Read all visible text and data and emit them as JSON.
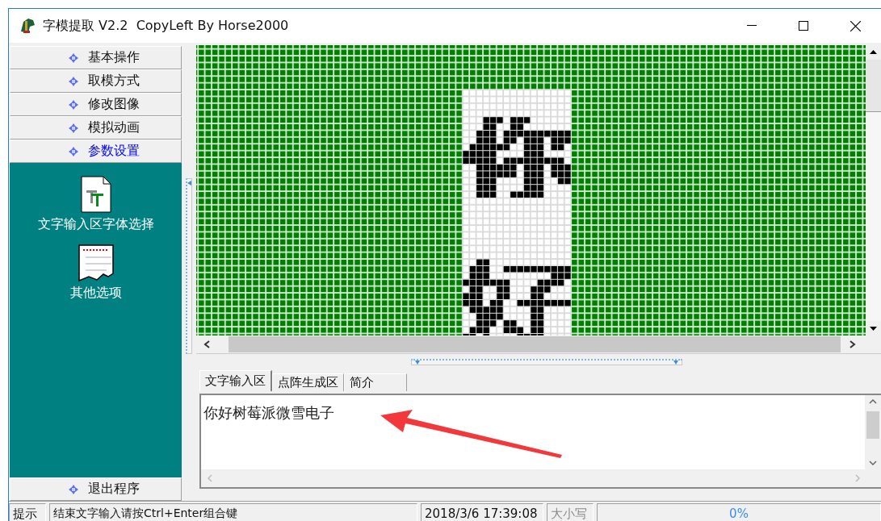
{
  "window": {
    "title": "字模提取 V2.2  CopyLeft By Horse2000"
  },
  "sidebar": {
    "items": [
      {
        "label": "基本操作",
        "selected": false
      },
      {
        "label": "取模方式",
        "selected": false
      },
      {
        "label": "修改图像",
        "selected": false
      },
      {
        "label": "模拟动画",
        "selected": false
      },
      {
        "label": "参数设置",
        "selected": true
      }
    ],
    "panel_items": [
      {
        "label": "文字输入区字体选择",
        "kind": "font"
      },
      {
        "label": "其他选项",
        "kind": "options"
      }
    ],
    "footer_item": {
      "label": "退出程序"
    }
  },
  "tabs": [
    {
      "label": "文字输入区",
      "selected": true
    },
    {
      "label": "点阵生成区",
      "selected": false
    },
    {
      "label": "简介",
      "selected": false
    }
  ],
  "text_input": {
    "value": "你好树莓派微雪电子"
  },
  "status_bar": {
    "label": "提示",
    "message": "结束文字输入请按Ctrl+Enter组合键",
    "datetime": "2018/3/6 17:39:08",
    "caps": {
      "label": "大小写",
      "disabled": true
    },
    "progress": {
      "level": 0,
      "reading": "0%"
    }
  }
}
